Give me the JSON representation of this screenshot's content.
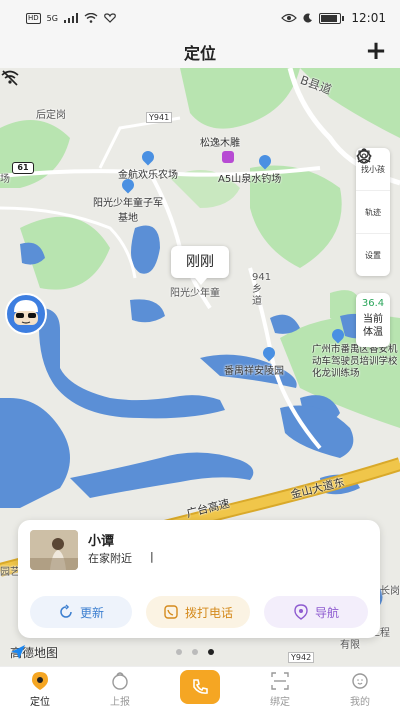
{
  "status_bar": {
    "hd": "HD",
    "signal": "5G",
    "battery_text": "100",
    "time": "12:01"
  },
  "header": {
    "title": "定位",
    "add_symbol": "+"
  },
  "map": {
    "battery_level": "61",
    "labels": {
      "road_b": "B县道",
      "road_y941": "Y941",
      "road_y942": "Y942",
      "dinggang": "后定岗",
      "farm": "金航欢乐农场",
      "pine": "松逸木雕",
      "fishing": "A5山泉水钓场",
      "youth_base": "阳光少年童子军基地",
      "youth_base2": "阳光少年童",
      "xiangdao": "941乡道",
      "cemetery": "番禺祥安陵园",
      "driving_school": "广州市番禺区香安机动车驾驶员培训学校化龙训练场",
      "guangtai": "广台高速",
      "jinshan": "金山大道东",
      "hongcheng": "宏诚万工程有限",
      "changgang": "长岗",
      "amap": "高德地图",
      "field": "场",
      "yi": "园艺"
    },
    "time_bubble": "刚刚",
    "side_panel": {
      "find_child": "找小孩",
      "track": "轨迹",
      "settings": "设置"
    },
    "temperature": {
      "value": "36.4",
      "label_line1": "当前",
      "label_line2": "体温"
    }
  },
  "card": {
    "name": "小谭",
    "location": "在家附近",
    "buttons": {
      "refresh": "更新",
      "call": "拨打电话",
      "navigate": "导航"
    }
  },
  "pager": {
    "count": 3,
    "active": 2
  },
  "bottom_nav": {
    "locate": "定位",
    "report": "上报",
    "bind": "绑定",
    "mine": "我的"
  },
  "colors": {
    "accent": "#f5a623",
    "water": "#5b8fd6",
    "green": "#b8e4b0",
    "highway": "#f0c64a",
    "temp": "#2aa55a"
  }
}
